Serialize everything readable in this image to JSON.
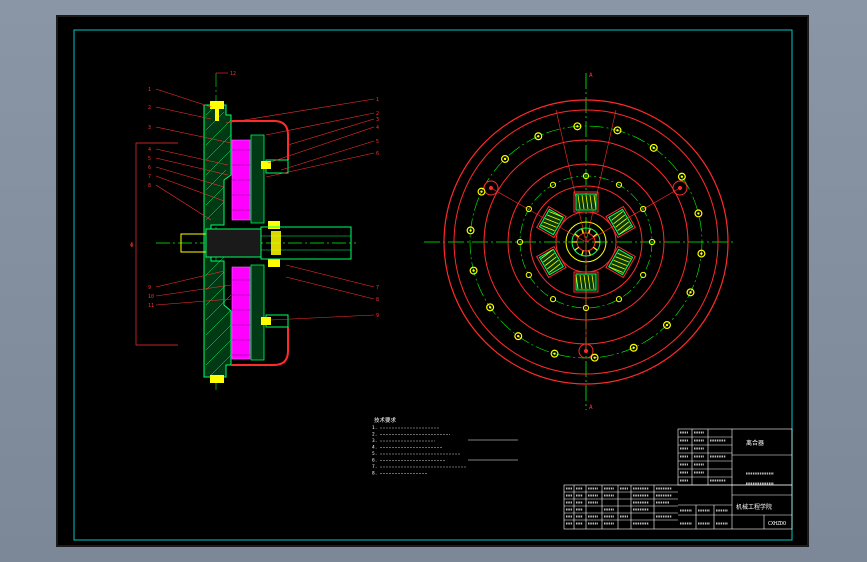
{
  "drawing": {
    "tech_requirements": {
      "title": "技术要求",
      "lines": [
        "1.",
        "2.",
        "3.",
        "4.",
        "5.",
        "6.",
        "7.",
        "8."
      ]
    },
    "title_block": {
      "drawing_name": "离合器",
      "drawing_number": "CXHZDO",
      "school": "机械工程学院"
    },
    "callouts_left": [
      "1",
      "2",
      "3",
      "4",
      "5",
      "6",
      "7",
      "8",
      "9",
      "10",
      "11",
      "12"
    ],
    "callouts_right": [
      "1",
      "2",
      "3",
      "4",
      "5",
      "6",
      "7",
      "8",
      "9"
    ],
    "colors": {
      "frame": "#ffffff",
      "border": "#00c8c8",
      "outline": "#ff2a2a",
      "center_line": "#00ff00",
      "hatch": "#00ff66",
      "friction": "#ff00ff",
      "bolt": "#ffff00",
      "dim": "#ff3030"
    }
  }
}
